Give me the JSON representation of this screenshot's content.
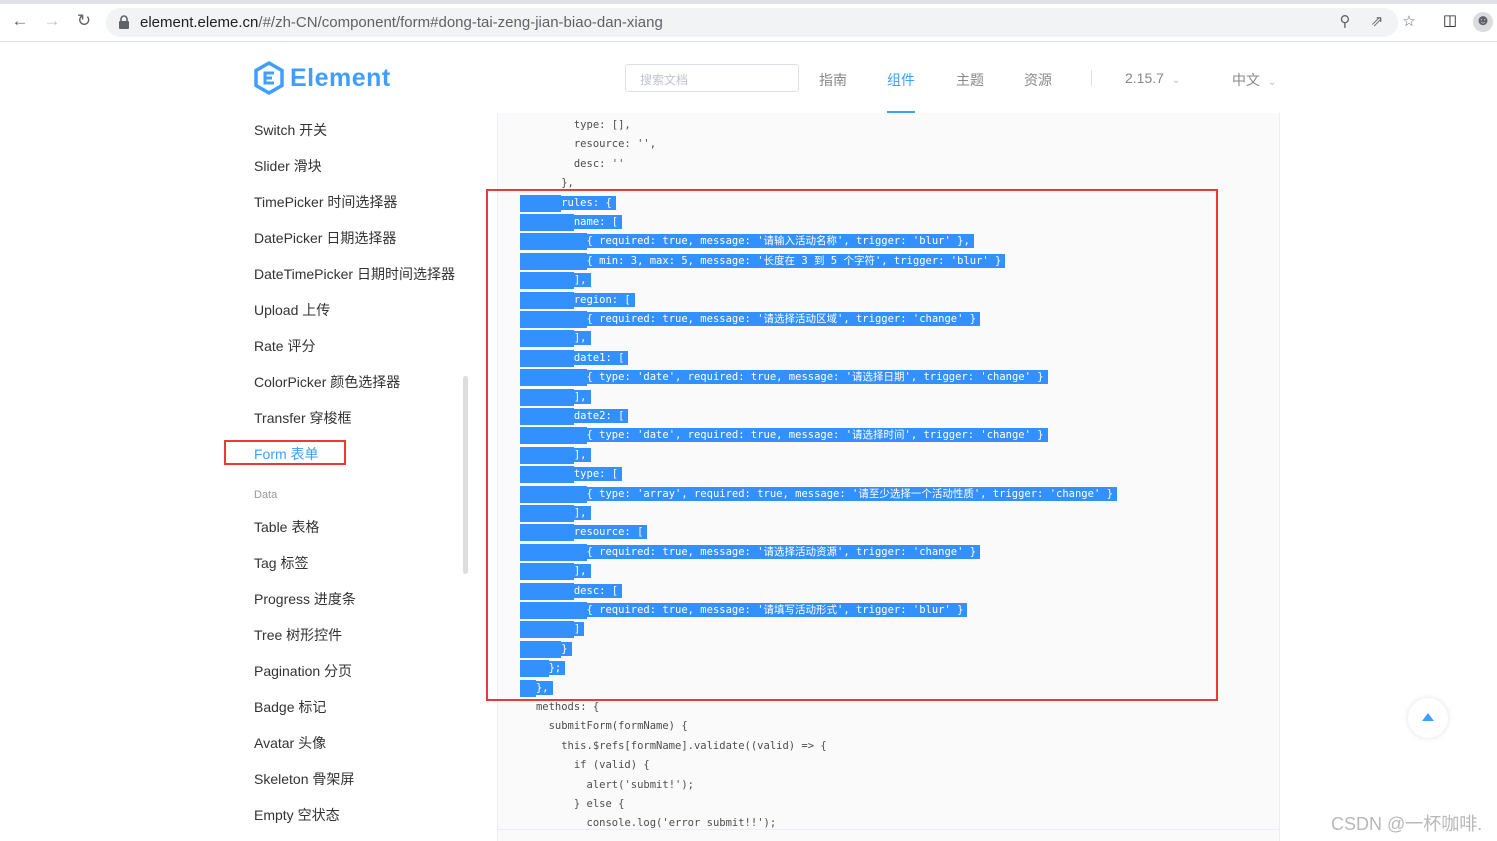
{
  "browser": {
    "url_host": "element.eleme.cn",
    "url_path": "/#/zh-CN/component/form#dong-tai-zeng-jian-biao-dan-xiang"
  },
  "header": {
    "brand": "Element",
    "search_placeholder": "搜索文档",
    "nav": [
      "指南",
      "组件",
      "主题",
      "资源"
    ],
    "active_nav": "组件",
    "version": "2.15.7",
    "language": "中文",
    "accent_color": "#409eff"
  },
  "sidebar": {
    "items_top": [
      "Switch 开关",
      "Slider 滑块",
      "TimePicker 时间选择器",
      "DatePicker 日期选择器",
      "DateTimePicker 日期时间选择器",
      "Upload 上传",
      "Rate 评分",
      "ColorPicker 颜色选择器",
      "Transfer 穿梭框",
      "Form 表单"
    ],
    "active_item": "Form 表单",
    "group_label": "Data",
    "items_data": [
      "Table 表格",
      "Tag 标签",
      "Progress 进度条",
      "Tree 树形控件",
      "Pagination 分页",
      "Badge 标记",
      "Avatar 头像",
      "Skeleton 骨架屏",
      "Empty 空状态"
    ]
  },
  "code": {
    "lines": [
      {
        "text": "            type: [],",
        "sel": false
      },
      {
        "text": "            resource: '',",
        "sel": false
      },
      {
        "text": "            desc: ''",
        "sel": false
      },
      {
        "text": "          },",
        "sel": false
      },
      {
        "text": "          rules: {",
        "sel": true
      },
      {
        "text": "            name: [",
        "sel": true
      },
      {
        "text": "              { required: true, message: '请输入活动名称', trigger: 'blur' },",
        "sel": true
      },
      {
        "text": "              { min: 3, max: 5, message: '长度在 3 到 5 个字符', trigger: 'blur' }",
        "sel": true
      },
      {
        "text": "            ],",
        "sel": true
      },
      {
        "text": "            region: [",
        "sel": true
      },
      {
        "text": "              { required: true, message: '请选择活动区域', trigger: 'change' }",
        "sel": true
      },
      {
        "text": "            ],",
        "sel": true
      },
      {
        "text": "            date1: [",
        "sel": true
      },
      {
        "text": "              { type: 'date', required: true, message: '请选择日期', trigger: 'change' }",
        "sel": true
      },
      {
        "text": "            ],",
        "sel": true
      },
      {
        "text": "            date2: [",
        "sel": true
      },
      {
        "text": "              { type: 'date', required: true, message: '请选择时间', trigger: 'change' }",
        "sel": true
      },
      {
        "text": "            ],",
        "sel": true
      },
      {
        "text": "            type: [",
        "sel": true
      },
      {
        "text": "              { type: 'array', required: true, message: '请至少选择一个活动性质', trigger: 'change' }",
        "sel": true
      },
      {
        "text": "            ],",
        "sel": true
      },
      {
        "text": "            resource: [",
        "sel": true
      },
      {
        "text": "              { required: true, message: '请选择活动资源', trigger: 'change' }",
        "sel": true
      },
      {
        "text": "            ],",
        "sel": true
      },
      {
        "text": "            desc: [",
        "sel": true
      },
      {
        "text": "              { required: true, message: '请填写活动形式', trigger: 'blur' }",
        "sel": true
      },
      {
        "text": "            ]",
        "sel": true
      },
      {
        "text": "          }",
        "sel": true
      },
      {
        "text": "        };",
        "sel": true
      },
      {
        "text": "      },",
        "sel": true
      },
      {
        "text": "      methods: {",
        "sel": false
      },
      {
        "text": "        submitForm(formName) {",
        "sel": false
      },
      {
        "text": "          this.$refs[formName].validate((valid) => {",
        "sel": false
      },
      {
        "text": "            if (valid) {",
        "sel": false
      },
      {
        "text": "              alert('submit!');",
        "sel": false
      },
      {
        "text": "            } else {",
        "sel": false
      },
      {
        "text": "              console.log('error submit!!');",
        "sel": false
      }
    ]
  },
  "watermark": "CSDN @一杯咖啡."
}
